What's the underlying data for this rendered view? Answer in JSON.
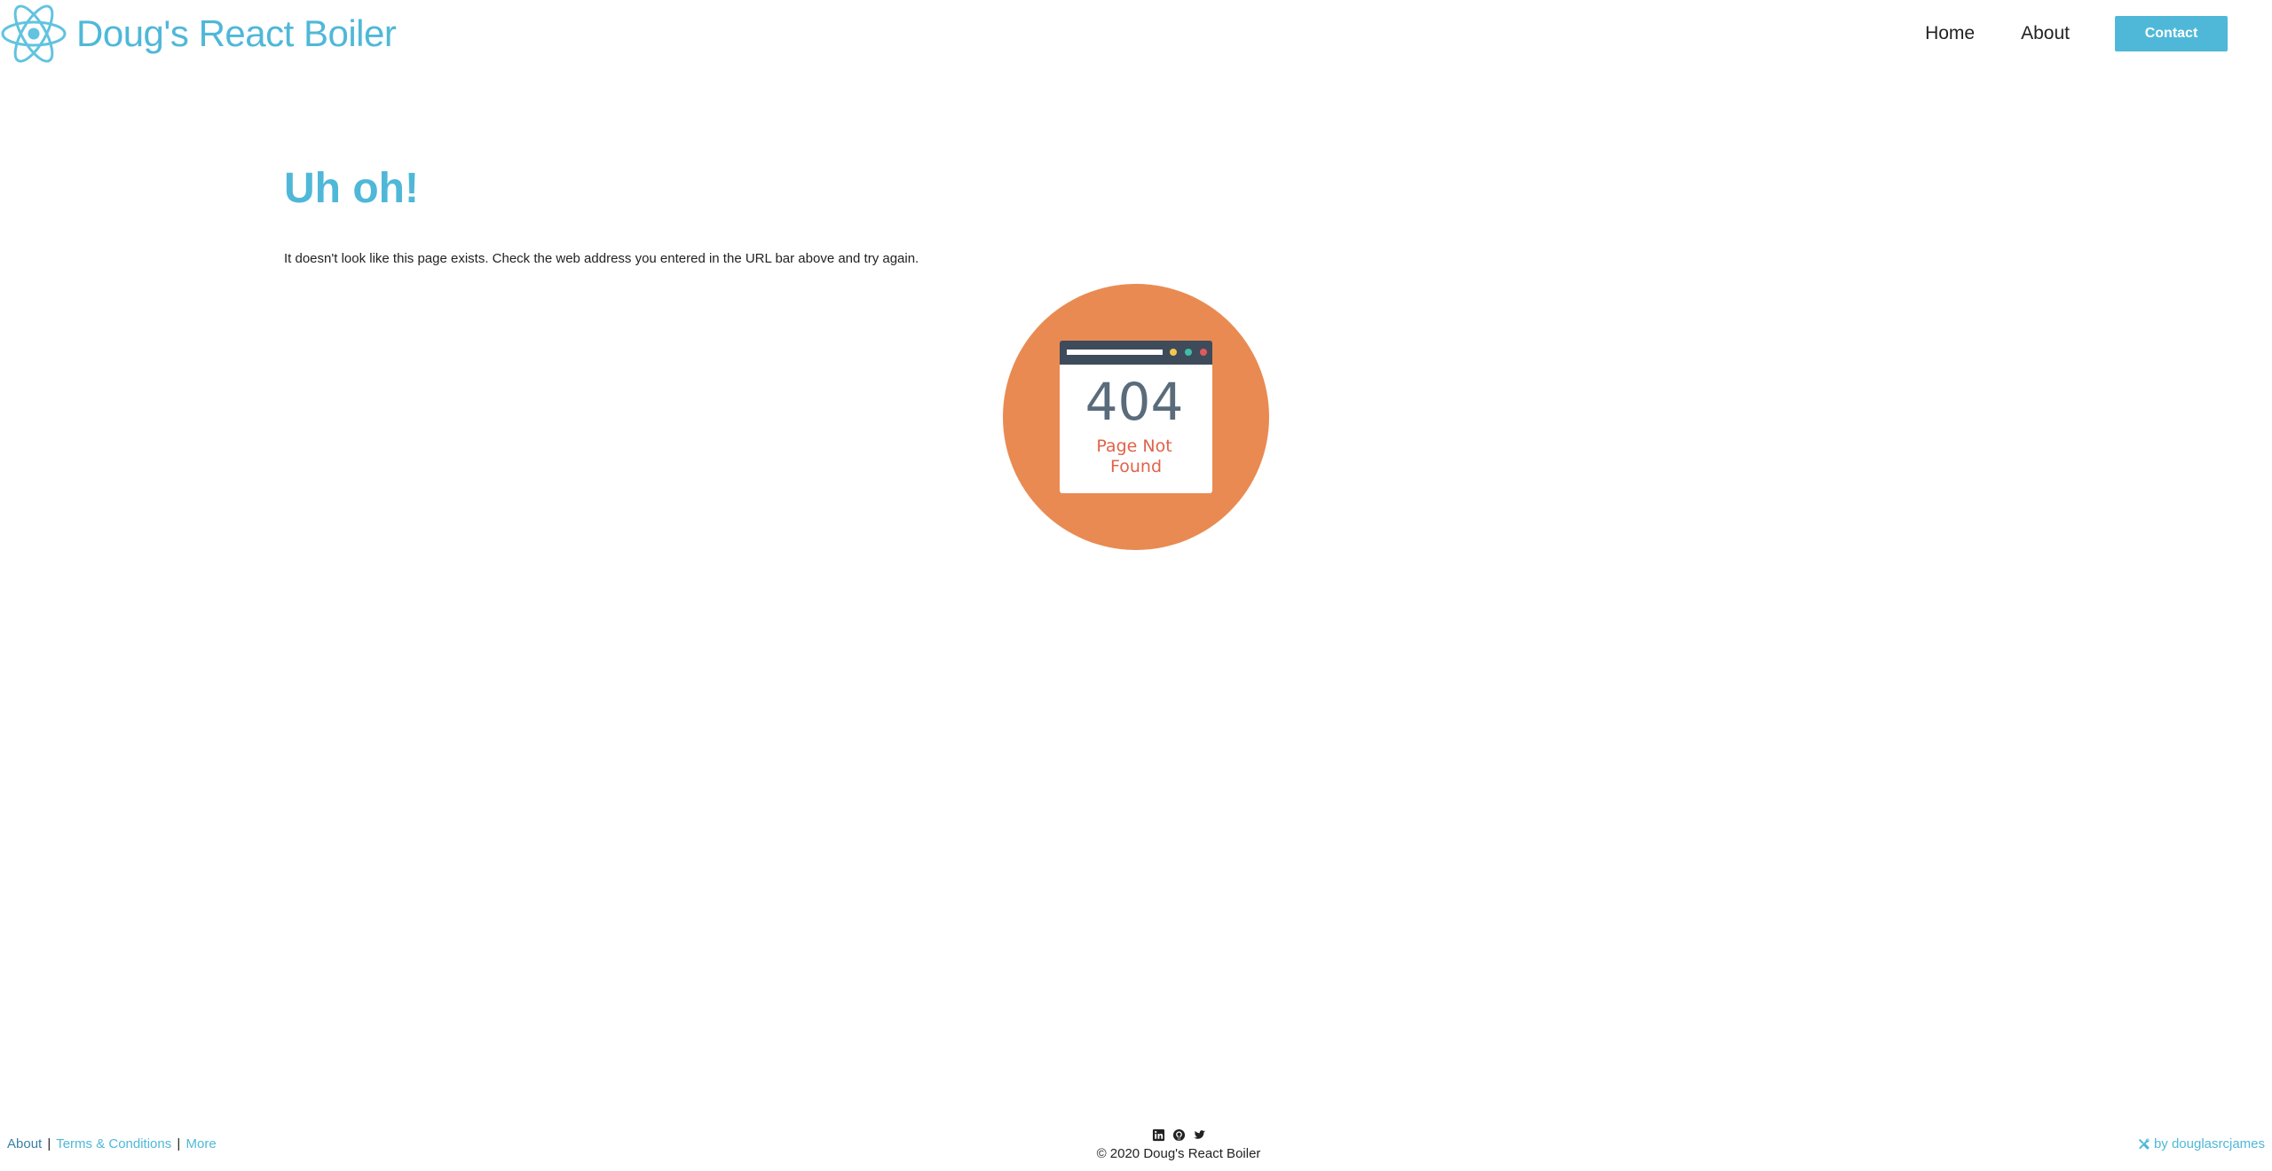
{
  "header": {
    "brand_name": "Doug's React Boiler",
    "nav": {
      "home_label": "Home",
      "about_label": "About",
      "contact_label": "Contact"
    }
  },
  "main": {
    "title": "Uh oh!",
    "message": "It doesn't look like this page exists. Check the web address you entered in the URL bar above and try again.",
    "illustration": {
      "code": "404",
      "caption_line1": "Page Not",
      "caption_line2": "Found"
    }
  },
  "footer": {
    "links": {
      "about_label": "About",
      "separator": "|",
      "terms_label": "Terms & Conditions",
      "more_label": "More"
    },
    "social_icons": [
      "linkedin-icon",
      "github-icon",
      "twitter-icon"
    ],
    "copyright": "© 2020 Doug's React Boiler",
    "credit": "by douglasrcjames"
  },
  "colors": {
    "accent": "#4fb8d8",
    "illustration_circle": "#e98a52",
    "browser_bar": "#3e4b5b",
    "code_text": "#5a6b7b",
    "caption_text": "#e0634a"
  }
}
